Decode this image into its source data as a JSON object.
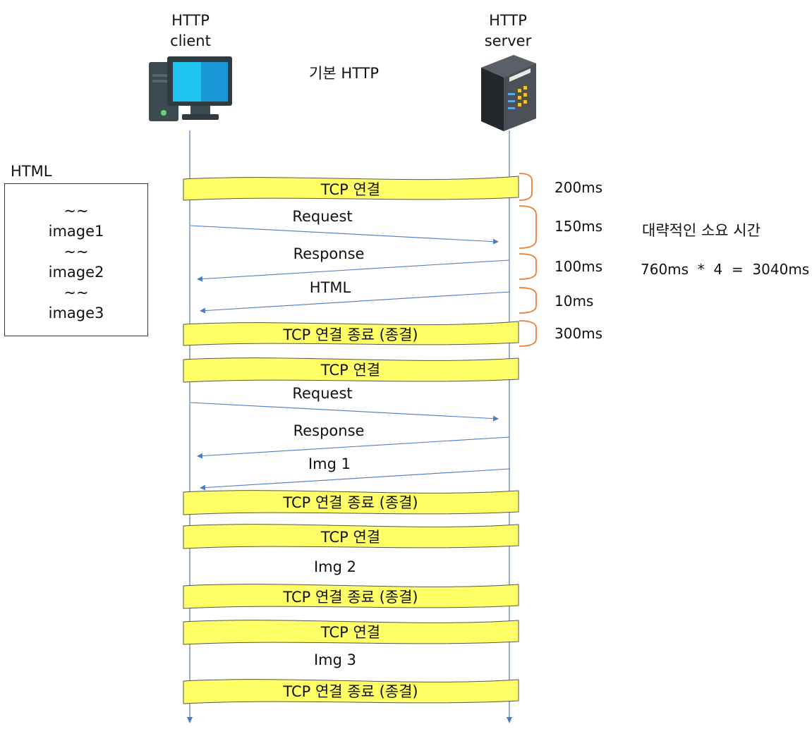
{
  "header": {
    "client_line1": "HTTP",
    "client_line2": "client",
    "server_line1": "HTTP",
    "server_line2": "server",
    "title": "기본 HTTP"
  },
  "html_doc": {
    "label": "HTML",
    "lines": [
      "~~",
      "image1",
      "~~",
      "image2",
      "~~",
      "image3"
    ]
  },
  "bands": {
    "tcp_connect": "TCP 연결",
    "tcp_close": "TCP 연결 종료 (종결)"
  },
  "messages": {
    "request": "Request",
    "response": "Response",
    "html": "HTML",
    "img1": "Img 1",
    "img2": "Img 2",
    "img3": "Img 3"
  },
  "timings": {
    "t1": "200ms",
    "t2": "150ms",
    "t3": "100ms",
    "t4": "10ms",
    "t5": "300ms"
  },
  "summary": {
    "label": "대략적인 소요 시간",
    "formula": "760ms  *  4  =  3040ms"
  },
  "colors": {
    "band_fill": "#ffff66",
    "arrow": "#4a7cc0",
    "bracket": "#ed7d31",
    "lifeline": "#4a7cc0"
  },
  "icons": {
    "client": "desktop-computer-icon",
    "server": "server-rack-icon"
  }
}
